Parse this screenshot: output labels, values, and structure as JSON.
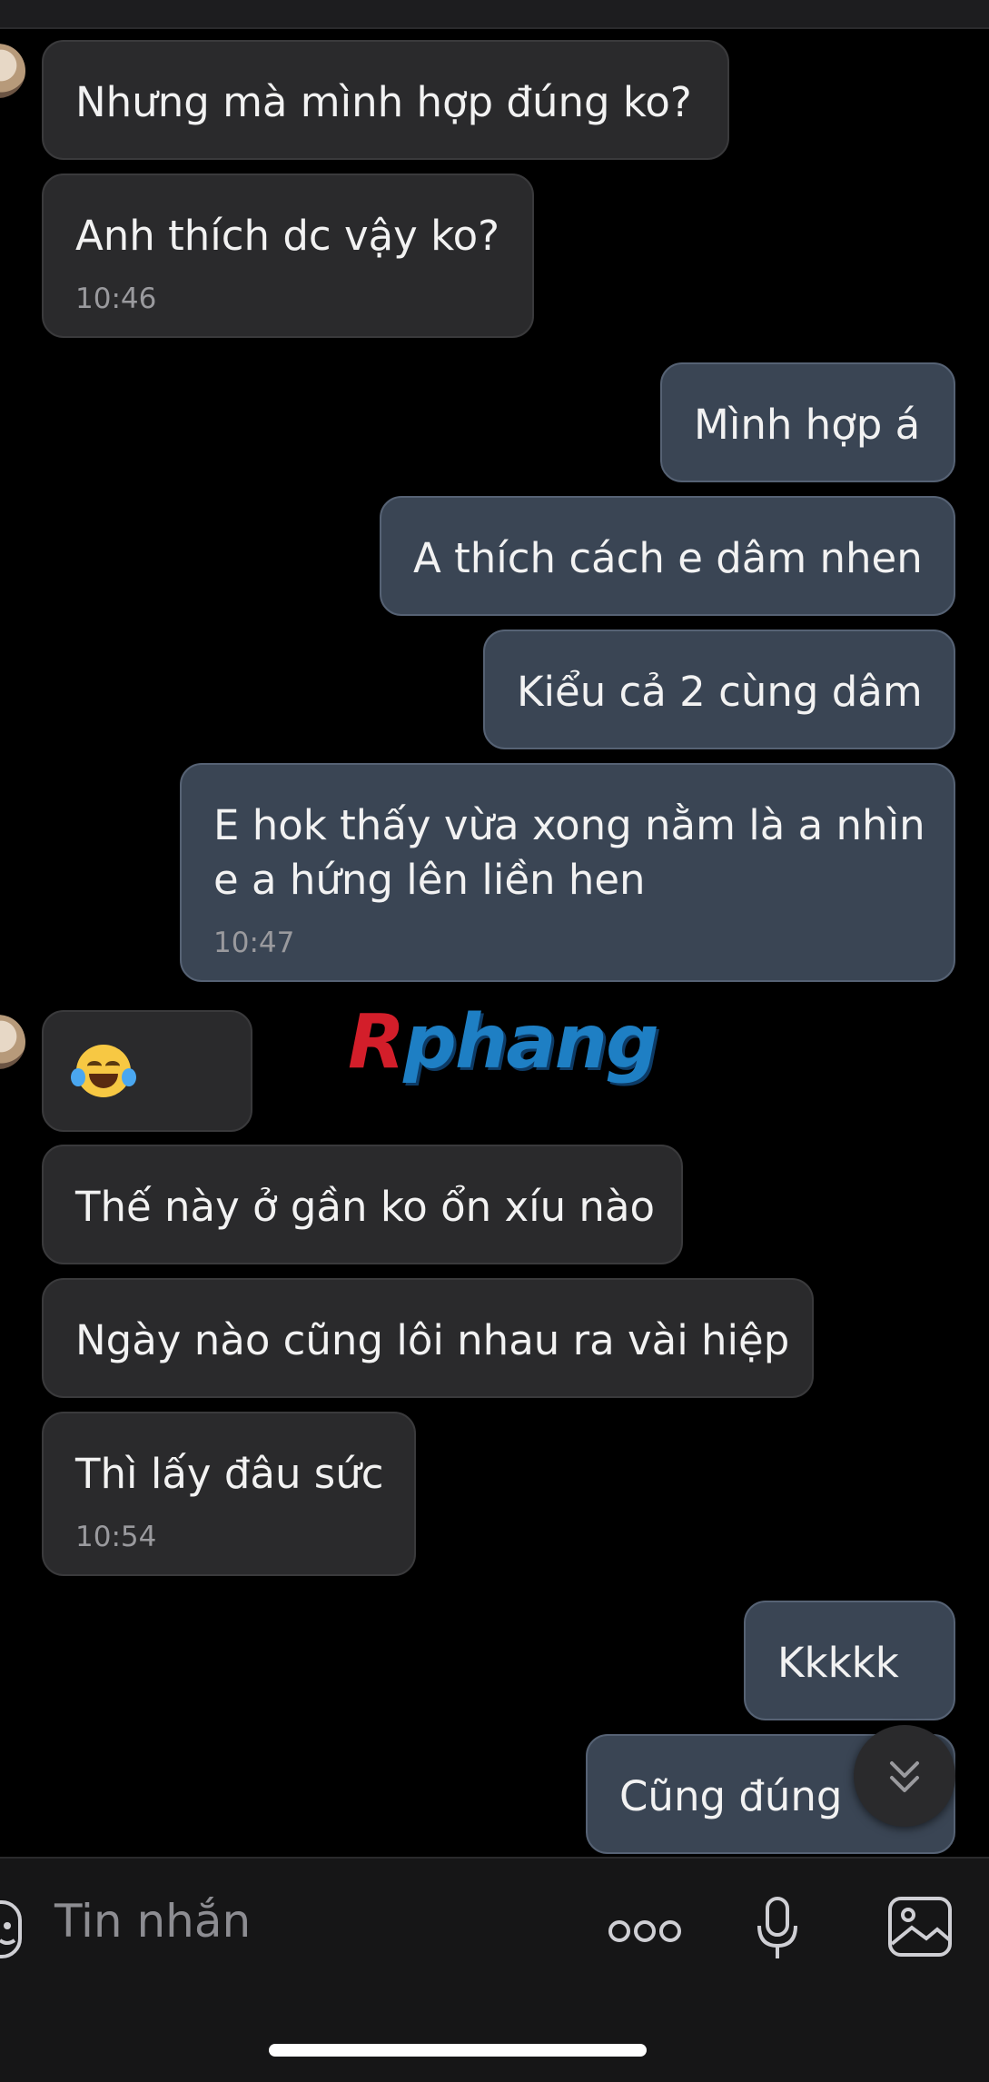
{
  "messages": [
    {
      "text": "Nhưng mà mình hợp đúng ko?",
      "time": ""
    },
    {
      "text": "Anh thích dc vậy ko?",
      "time": "10:46"
    },
    {
      "text": "Mình hợp á",
      "time": ""
    },
    {
      "text": "A thích cách e dâm nhen",
      "time": ""
    },
    {
      "text": "Kiểu cả 2 cùng dâm",
      "time": ""
    },
    {
      "text_line1": "E hok thấy vừa xong nằm là a nhìn",
      "text_line2": "e a hứng lên liền hen",
      "time": "10:47"
    },
    {
      "emoji": "face-with-tears-of-joy",
      "time": ""
    },
    {
      "text": "Thế này ở gần ko ổn xíu nào",
      "time": ""
    },
    {
      "text": "Ngày nào cũng lôi nhau ra vài hiệp",
      "time": ""
    },
    {
      "text": "Thì lấy đâu sức",
      "time": "10:54"
    },
    {
      "text": "Kkkkk",
      "time": ""
    },
    {
      "text": "Cũng đúng",
      "time": ""
    }
  ],
  "watermark": {
    "first": "R",
    "rest": "phang"
  },
  "composer": {
    "placeholder": "Tin nhắn"
  },
  "icons": {
    "scroll": "chevrons-down-icon",
    "sticker": "sticker-icon",
    "more": "more-icon",
    "mic": "microphone-icon",
    "image": "image-icon"
  },
  "colors": {
    "incoming_bubble": "#2a2a2c",
    "outgoing_bubble": "#3a4554",
    "background": "#000000"
  }
}
